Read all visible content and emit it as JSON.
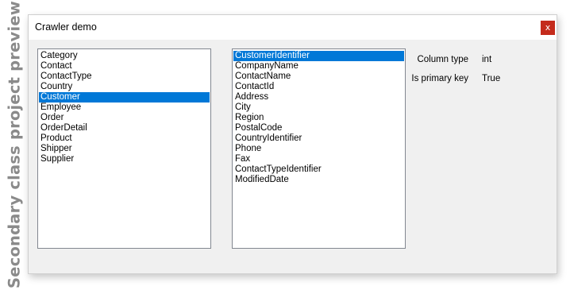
{
  "watermark": "Secondary class project preview",
  "window": {
    "title": "Crawler demo",
    "close_label": "x"
  },
  "tables_list": {
    "items": [
      "Category",
      "Contact",
      "ContactType",
      "Country",
      "Customer",
      "Employee",
      "Order",
      "OrderDetail",
      "Product",
      "Shipper",
      "Supplier"
    ],
    "selected": "Customer"
  },
  "columns_list": {
    "items": [
      "CustomerIdentifier",
      "CompanyName",
      "ContactName",
      "ContactId",
      "Address",
      "City",
      "Region",
      "PostalCode",
      "CountryIdentifier",
      "Phone",
      "Fax",
      "ContactTypeIdentifier",
      "ModifiedDate"
    ],
    "selected": "CustomerIdentifier"
  },
  "properties": {
    "column_type_label": "Column type",
    "column_type_value": "int",
    "primary_key_label": "Is primary key",
    "primary_key_value": "True"
  },
  "colors": {
    "selection": "#0078d7",
    "close_button": "#c42b1c"
  }
}
